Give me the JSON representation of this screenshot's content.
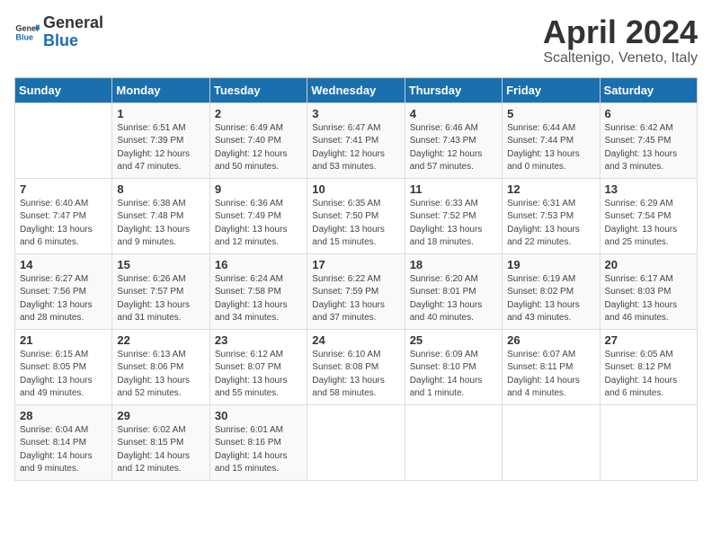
{
  "header": {
    "logo_general": "General",
    "logo_blue": "Blue",
    "month_title": "April 2024",
    "location": "Scaltenigo, Veneto, Italy"
  },
  "days_of_week": [
    "Sunday",
    "Monday",
    "Tuesday",
    "Wednesday",
    "Thursday",
    "Friday",
    "Saturday"
  ],
  "weeks": [
    [
      {
        "day": "",
        "sunrise": "",
        "sunset": "",
        "daylight": ""
      },
      {
        "day": "1",
        "sunrise": "Sunrise: 6:51 AM",
        "sunset": "Sunset: 7:39 PM",
        "daylight": "Daylight: 12 hours and 47 minutes."
      },
      {
        "day": "2",
        "sunrise": "Sunrise: 6:49 AM",
        "sunset": "Sunset: 7:40 PM",
        "daylight": "Daylight: 12 hours and 50 minutes."
      },
      {
        "day": "3",
        "sunrise": "Sunrise: 6:47 AM",
        "sunset": "Sunset: 7:41 PM",
        "daylight": "Daylight: 12 hours and 53 minutes."
      },
      {
        "day": "4",
        "sunrise": "Sunrise: 6:46 AM",
        "sunset": "Sunset: 7:43 PM",
        "daylight": "Daylight: 12 hours and 57 minutes."
      },
      {
        "day": "5",
        "sunrise": "Sunrise: 6:44 AM",
        "sunset": "Sunset: 7:44 PM",
        "daylight": "Daylight: 13 hours and 0 minutes."
      },
      {
        "day": "6",
        "sunrise": "Sunrise: 6:42 AM",
        "sunset": "Sunset: 7:45 PM",
        "daylight": "Daylight: 13 hours and 3 minutes."
      }
    ],
    [
      {
        "day": "7",
        "sunrise": "Sunrise: 6:40 AM",
        "sunset": "Sunset: 7:47 PM",
        "daylight": "Daylight: 13 hours and 6 minutes."
      },
      {
        "day": "8",
        "sunrise": "Sunrise: 6:38 AM",
        "sunset": "Sunset: 7:48 PM",
        "daylight": "Daylight: 13 hours and 9 minutes."
      },
      {
        "day": "9",
        "sunrise": "Sunrise: 6:36 AM",
        "sunset": "Sunset: 7:49 PM",
        "daylight": "Daylight: 13 hours and 12 minutes."
      },
      {
        "day": "10",
        "sunrise": "Sunrise: 6:35 AM",
        "sunset": "Sunset: 7:50 PM",
        "daylight": "Daylight: 13 hours and 15 minutes."
      },
      {
        "day": "11",
        "sunrise": "Sunrise: 6:33 AM",
        "sunset": "Sunset: 7:52 PM",
        "daylight": "Daylight: 13 hours and 18 minutes."
      },
      {
        "day": "12",
        "sunrise": "Sunrise: 6:31 AM",
        "sunset": "Sunset: 7:53 PM",
        "daylight": "Daylight: 13 hours and 22 minutes."
      },
      {
        "day": "13",
        "sunrise": "Sunrise: 6:29 AM",
        "sunset": "Sunset: 7:54 PM",
        "daylight": "Daylight: 13 hours and 25 minutes."
      }
    ],
    [
      {
        "day": "14",
        "sunrise": "Sunrise: 6:27 AM",
        "sunset": "Sunset: 7:56 PM",
        "daylight": "Daylight: 13 hours and 28 minutes."
      },
      {
        "day": "15",
        "sunrise": "Sunrise: 6:26 AM",
        "sunset": "Sunset: 7:57 PM",
        "daylight": "Daylight: 13 hours and 31 minutes."
      },
      {
        "day": "16",
        "sunrise": "Sunrise: 6:24 AM",
        "sunset": "Sunset: 7:58 PM",
        "daylight": "Daylight: 13 hours and 34 minutes."
      },
      {
        "day": "17",
        "sunrise": "Sunrise: 6:22 AM",
        "sunset": "Sunset: 7:59 PM",
        "daylight": "Daylight: 13 hours and 37 minutes."
      },
      {
        "day": "18",
        "sunrise": "Sunrise: 6:20 AM",
        "sunset": "Sunset: 8:01 PM",
        "daylight": "Daylight: 13 hours and 40 minutes."
      },
      {
        "day": "19",
        "sunrise": "Sunrise: 6:19 AM",
        "sunset": "Sunset: 8:02 PM",
        "daylight": "Daylight: 13 hours and 43 minutes."
      },
      {
        "day": "20",
        "sunrise": "Sunrise: 6:17 AM",
        "sunset": "Sunset: 8:03 PM",
        "daylight": "Daylight: 13 hours and 46 minutes."
      }
    ],
    [
      {
        "day": "21",
        "sunrise": "Sunrise: 6:15 AM",
        "sunset": "Sunset: 8:05 PM",
        "daylight": "Daylight: 13 hours and 49 minutes."
      },
      {
        "day": "22",
        "sunrise": "Sunrise: 6:13 AM",
        "sunset": "Sunset: 8:06 PM",
        "daylight": "Daylight: 13 hours and 52 minutes."
      },
      {
        "day": "23",
        "sunrise": "Sunrise: 6:12 AM",
        "sunset": "Sunset: 8:07 PM",
        "daylight": "Daylight: 13 hours and 55 minutes."
      },
      {
        "day": "24",
        "sunrise": "Sunrise: 6:10 AM",
        "sunset": "Sunset: 8:08 PM",
        "daylight": "Daylight: 13 hours and 58 minutes."
      },
      {
        "day": "25",
        "sunrise": "Sunrise: 6:09 AM",
        "sunset": "Sunset: 8:10 PM",
        "daylight": "Daylight: 14 hours and 1 minute."
      },
      {
        "day": "26",
        "sunrise": "Sunrise: 6:07 AM",
        "sunset": "Sunset: 8:11 PM",
        "daylight": "Daylight: 14 hours and 4 minutes."
      },
      {
        "day": "27",
        "sunrise": "Sunrise: 6:05 AM",
        "sunset": "Sunset: 8:12 PM",
        "daylight": "Daylight: 14 hours and 6 minutes."
      }
    ],
    [
      {
        "day": "28",
        "sunrise": "Sunrise: 6:04 AM",
        "sunset": "Sunset: 8:14 PM",
        "daylight": "Daylight: 14 hours and 9 minutes."
      },
      {
        "day": "29",
        "sunrise": "Sunrise: 6:02 AM",
        "sunset": "Sunset: 8:15 PM",
        "daylight": "Daylight: 14 hours and 12 minutes."
      },
      {
        "day": "30",
        "sunrise": "Sunrise: 6:01 AM",
        "sunset": "Sunset: 8:16 PM",
        "daylight": "Daylight: 14 hours and 15 minutes."
      },
      {
        "day": "",
        "sunrise": "",
        "sunset": "",
        "daylight": ""
      },
      {
        "day": "",
        "sunrise": "",
        "sunset": "",
        "daylight": ""
      },
      {
        "day": "",
        "sunrise": "",
        "sunset": "",
        "daylight": ""
      },
      {
        "day": "",
        "sunrise": "",
        "sunset": "",
        "daylight": ""
      }
    ]
  ]
}
